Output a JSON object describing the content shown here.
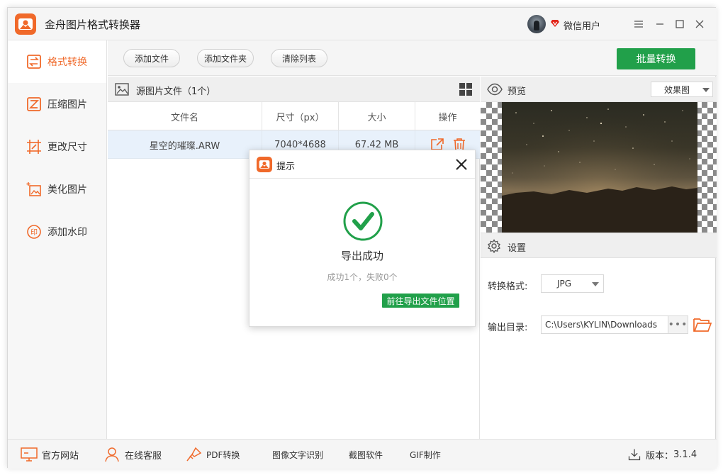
{
  "app": {
    "title": "金舟图片格式转换器",
    "user_name": "微信用户",
    "accent_color": "#f0692a",
    "green_color": "#21a04a"
  },
  "sidebar": {
    "items": [
      {
        "label": "格式转换",
        "icon": "format-convert-icon",
        "active": true
      },
      {
        "label": "压缩图片",
        "icon": "compress-icon",
        "active": false
      },
      {
        "label": "更改尺寸",
        "icon": "resize-icon",
        "active": false
      },
      {
        "label": "美化图片",
        "icon": "beautify-icon",
        "active": false
      },
      {
        "label": "添加水印",
        "icon": "watermark-icon",
        "active": false
      }
    ]
  },
  "toolbar": {
    "add_file": "添加文件",
    "add_folder": "添加文件夹",
    "clear_list": "清除列表",
    "batch_convert": "批量转换"
  },
  "file_panel": {
    "title": "源图片文件（1个）",
    "columns": [
      "文件名",
      "尺寸（px）",
      "大小",
      "操作"
    ],
    "rows": [
      {
        "name": "星空的璀璨.ARW",
        "dimensions": "7040*4688",
        "size": "67.42 MB"
      }
    ]
  },
  "preview": {
    "title": "预览",
    "mode": "效果图"
  },
  "settings": {
    "title": "设置",
    "format_label": "转换格式:",
    "format_value": "JPG",
    "output_label": "输出目录:",
    "output_path": "C:\\Users\\KYLIN\\Downloads",
    "browse_dots": "•••"
  },
  "dialog": {
    "title": "提示",
    "message": "导出成功",
    "sub_message": "成功1个，失败0个",
    "open_location": "前往导出文件位置"
  },
  "footer": {
    "website": "官方网站",
    "support": "在线客服",
    "pdf": "PDF转换",
    "ocr": "图像文字识别",
    "screenshot": "截图软件",
    "gif": "GIF制作",
    "version_label": "版本：",
    "version": "3.1.4"
  }
}
